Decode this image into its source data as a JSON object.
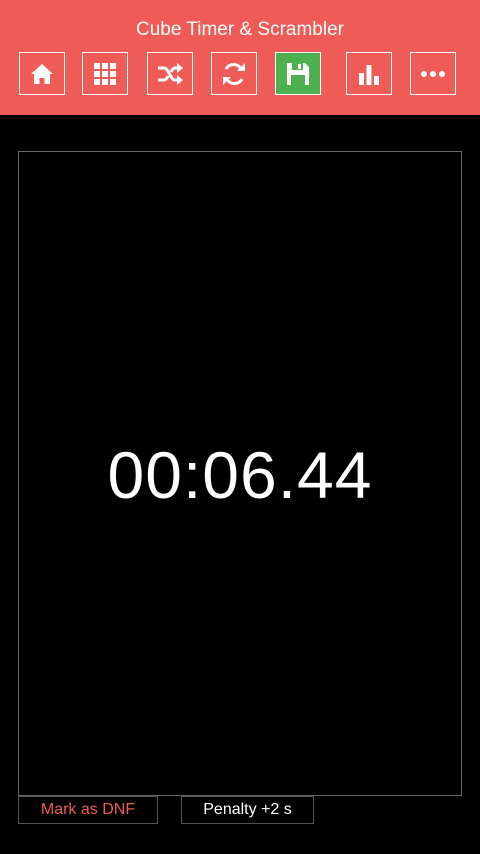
{
  "header": {
    "title": "Cube Timer & Scrambler",
    "background_color": "#ef5b56",
    "toolbar": [
      {
        "name": "home",
        "icon": "home-icon",
        "active": false
      },
      {
        "name": "grid",
        "icon": "grid-icon",
        "active": false
      },
      {
        "name": "scramble",
        "icon": "shuffle-icon",
        "active": false
      },
      {
        "name": "refresh",
        "icon": "refresh-icon",
        "active": false
      },
      {
        "name": "save",
        "icon": "save-icon",
        "active": true,
        "active_color": "#4caf50"
      },
      {
        "name": "stats",
        "icon": "bar-chart-icon",
        "active": false
      },
      {
        "name": "more",
        "icon": "more-icon",
        "active": false
      }
    ]
  },
  "timer": {
    "display": "00:06.44"
  },
  "actions": {
    "dnf_label": "Mark as DNF",
    "dnf_color": "#ef5b56",
    "penalty_label": "Penalty +2 s"
  }
}
